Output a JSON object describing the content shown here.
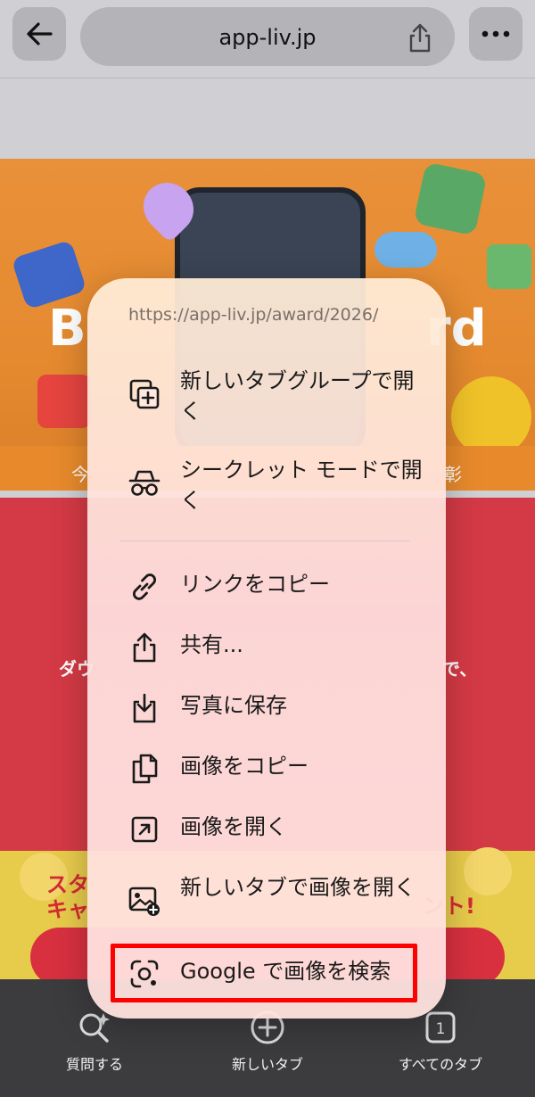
{
  "browser": {
    "url_domain": "app-liv.jp",
    "back_icon": "arrow-left-icon",
    "share_icon": "share-icon",
    "more_icon": "more-horizontal-icon"
  },
  "page": {
    "banner_left_text": "B",
    "banner_right_text": "rd",
    "strip_left": "今",
    "strip_right": "彰",
    "red_left": "ダウ",
    "red_right": "で、",
    "yellow_left_1": "スタ",
    "yellow_left_2": "キャ",
    "yellow_right": "ント!"
  },
  "context_menu": {
    "link_url": "https://app-liv.jp/award/2026/",
    "items": [
      {
        "label": "新しいタブグループで開く",
        "icon": "tab-group-icon"
      },
      {
        "label": "シークレット モードで開く",
        "icon": "incognito-icon"
      },
      {
        "label": "リンクをコピー",
        "icon": "link-icon"
      },
      {
        "label": "共有...",
        "icon": "share-icon"
      },
      {
        "label": "写真に保存",
        "icon": "save-download-icon"
      },
      {
        "label": "画像をコピー",
        "icon": "copy-image-icon"
      },
      {
        "label": "画像を開く",
        "icon": "open-external-icon"
      },
      {
        "label": "新しいタブで画像を開く",
        "icon": "image-add-icon"
      },
      {
        "label": "Google で画像を検索",
        "icon": "google-lens-icon"
      }
    ]
  },
  "toolbar": {
    "ask_label": "質問する",
    "new_tab_label": "新しいタブ",
    "all_tabs_label": "すべてのタブ",
    "tab_count": "1"
  },
  "colors": {
    "highlight": "#ff0000",
    "banner": "#e58a2f",
    "red_section": "#d43a45",
    "yellow_section": "#e7cb4b"
  }
}
